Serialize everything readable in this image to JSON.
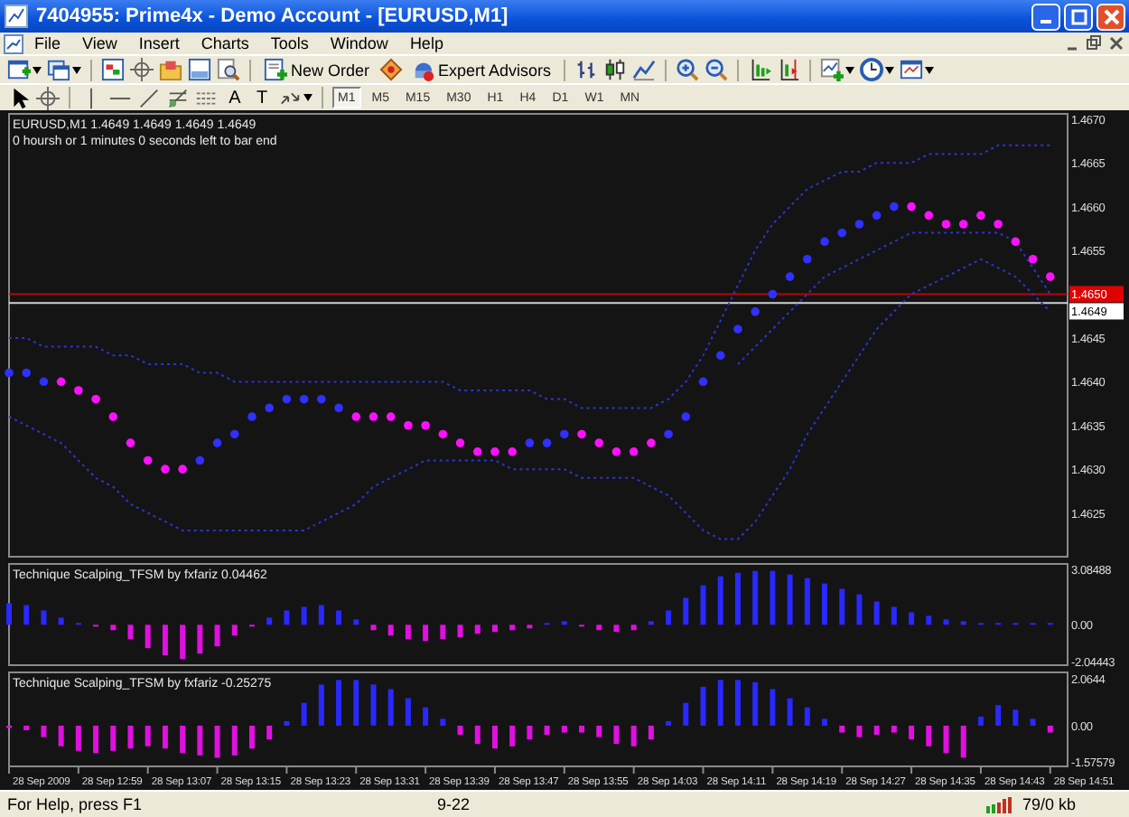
{
  "window": {
    "title": "7404955: Prime4x - Demo Account - [EURUSD,M1]"
  },
  "menu": [
    "File",
    "View",
    "Insert",
    "Charts",
    "Tools",
    "Window",
    "Help"
  ],
  "toolbar": {
    "new_order": "New Order",
    "expert_advisors": "Expert Advisors",
    "text_tool": "A",
    "label_tool": "T",
    "timeframes": [
      {
        "label": "M1",
        "selected": true
      },
      {
        "label": "M5",
        "selected": false
      },
      {
        "label": "M15",
        "selected": false
      },
      {
        "label": "M30",
        "selected": false
      },
      {
        "label": "H1",
        "selected": false
      },
      {
        "label": "H4",
        "selected": false
      },
      {
        "label": "D1",
        "selected": false
      },
      {
        "label": "W1",
        "selected": false
      },
      {
        "label": "MN",
        "selected": false
      }
    ]
  },
  "chart": {
    "countdown": "0 hoursh or 1 minutes 0 seconds left to bar end",
    "main": {
      "chart_data": {
        "type": "line",
        "title": "EURUSD,M1  1.4649 1.4649 1.4649 1.4649",
        "ylim": [
          1.462,
          1.46706
        ],
        "yticks": [
          {
            "value": 1.4625,
            "label": "1.4625"
          },
          {
            "value": 1.463,
            "label": "1.4630"
          },
          {
            "value": 1.4635,
            "label": "1.4635"
          },
          {
            "value": 1.464,
            "label": "1.4640"
          },
          {
            "value": 1.4645,
            "label": "1.4645"
          },
          {
            "value": 1.4655,
            "label": "1.4655"
          },
          {
            "value": 1.466,
            "label": "1.4660"
          },
          {
            "value": 1.4665,
            "label": "1.4665"
          },
          {
            "value": 1.467,
            "label": "1.4670"
          }
        ],
        "series": [
          {
            "color": "#2a35d0",
            "line_style": "dotted",
            "values": [
              1.4645,
              1.4645,
              1.4644,
              1.4644,
              1.4644,
              1.4644,
              1.4643,
              1.4643,
              1.4642,
              1.4642,
              1.4642,
              1.4641,
              1.4641,
              1.464,
              1.464,
              1.464,
              1.464,
              1.464,
              1.464,
              1.464,
              1.464,
              1.464,
              1.464,
              1.464,
              1.464,
              1.464,
              1.4639,
              1.4639,
              1.4639,
              1.4639,
              1.4639,
              1.4638,
              1.4638,
              1.4637,
              1.4637,
              1.4637,
              1.4637,
              1.4637,
              1.4638,
              1.464,
              1.4643,
              1.4647,
              1.4651,
              1.4655,
              1.4658,
              1.466,
              1.4662,
              1.4663,
              1.4664,
              1.4664,
              1.4665,
              1.4665,
              1.4665,
              1.4666,
              1.4666,
              1.4666,
              1.4666,
              1.4667,
              1.4667,
              1.4667,
              1.4667
            ]
          },
          {
            "color": "#2a35d0",
            "line_style": "dotted",
            "values": [
              1.4636,
              1.4635,
              1.4634,
              1.4633,
              1.4631,
              1.4629,
              1.4628,
              1.4626,
              1.4625,
              1.4624,
              1.4623,
              1.4623,
              1.4623,
              1.4623,
              1.4623,
              1.4623,
              1.4623,
              1.4623,
              1.4624,
              1.4625,
              1.4626,
              1.4628,
              1.4629,
              1.463,
              1.4631,
              1.4631,
              1.4631,
              1.4631,
              1.4631,
              1.463,
              1.463,
              1.463,
              1.463,
              1.4629,
              1.4629,
              1.4629,
              1.4629,
              1.4628,
              1.4627,
              1.4625,
              1.4623,
              1.4622,
              1.4622,
              1.4624,
              1.4627,
              1.463,
              1.4634,
              1.4637,
              1.464,
              1.4643,
              1.4646,
              1.4648,
              1.465,
              1.4651,
              1.4652,
              1.4653,
              1.4654,
              1.4653,
              1.4652,
              1.465,
              1.4648
            ]
          },
          {
            "color": "#2a35d0",
            "line_style": "dotted",
            "values": [
              null,
              null,
              null,
              null,
              null,
              null,
              null,
              null,
              null,
              null,
              null,
              null,
              null,
              null,
              null,
              null,
              null,
              null,
              null,
              null,
              null,
              null,
              null,
              null,
              null,
              null,
              null,
              null,
              null,
              null,
              null,
              null,
              null,
              null,
              null,
              null,
              null,
              null,
              null,
              null,
              null,
              null,
              1.4642,
              1.4644,
              1.4646,
              1.4648,
              1.465,
              1.4652,
              1.4653,
              1.4654,
              1.4655,
              1.4656,
              1.4657,
              1.4657,
              1.4657,
              1.4657,
              1.4657,
              1.4657,
              1.4656,
              1.4653,
              1.465
            ]
          },
          {
            "color": "#3030ff",
            "type": "scatter",
            "marker": "circle",
            "values": [
              1.4641,
              1.4641,
              1.464,
              null,
              null,
              null,
              null,
              null,
              null,
              null,
              null,
              1.4631,
              1.4633,
              1.4634,
              1.4636,
              1.4637,
              1.4638,
              1.4638,
              1.4638,
              1.4637,
              null,
              null,
              null,
              null,
              null,
              null,
              null,
              null,
              null,
              null,
              1.4633,
              1.4633,
              1.4634,
              null,
              null,
              null,
              null,
              null,
              1.4634,
              1.4636,
              1.464,
              1.4643,
              1.4646,
              1.4648,
              1.465,
              1.4652,
              1.4654,
              1.4656,
              1.4657,
              1.4658,
              1.4659,
              1.466,
              null,
              null,
              null,
              null,
              null,
              null,
              null,
              null,
              null
            ]
          },
          {
            "color": "#ff10ff",
            "type": "scatter",
            "marker": "circle",
            "values": [
              null,
              null,
              null,
              1.464,
              1.4639,
              1.4638,
              1.4636,
              1.4633,
              1.4631,
              1.463,
              1.463,
              null,
              null,
              null,
              null,
              null,
              null,
              null,
              null,
              null,
              1.4636,
              1.4636,
              1.4636,
              1.4635,
              1.4635,
              1.4634,
              1.4633,
              1.4632,
              1.4632,
              1.4632,
              null,
              null,
              null,
              1.4634,
              1.4633,
              1.4632,
              1.4632,
              1.4633,
              null,
              null,
              null,
              null,
              null,
              null,
              null,
              null,
              null,
              null,
              null,
              null,
              null,
              null,
              1.466,
              1.4659,
              1.4658,
              1.4658,
              1.4659,
              1.4658,
              1.4656,
              1.4654,
              1.4652
            ]
          }
        ],
        "ref_lines": [
          {
            "axis": "y",
            "value": 1.465,
            "label": "1.4650",
            "color": "#e00000"
          },
          {
            "axis": "y",
            "value": 1.4649,
            "label": "1.4649",
            "color": "#ffffff"
          }
        ]
      }
    },
    "indicator_1": {
      "chart_data": {
        "type": "bar",
        "title": "Technique Scalping_TFSM by fxfariz 0.04462",
        "ylim": [
          -2.25,
          3.39
        ],
        "yticks": [
          {
            "value": 3.08488,
            "label": "3.08488"
          },
          {
            "value": 0,
            "label": "0.00"
          },
          {
            "value": -2.04443,
            "label": "-2.04443"
          }
        ],
        "series": [
          {
            "color": "#2828ff",
            "values": [
              1.2,
              1.1,
              0.8,
              0.4,
              0.1,
              null,
              null,
              null,
              null,
              null,
              null,
              null,
              null,
              null,
              null,
              0.4,
              0.8,
              1.0,
              1.1,
              0.8,
              0.3,
              null,
              null,
              null,
              null,
              null,
              null,
              null,
              null,
              null,
              null,
              0.1,
              0.2,
              null,
              null,
              null,
              null,
              0.2,
              0.8,
              1.5,
              2.2,
              2.7,
              2.9,
              3.0,
              3.0,
              2.8,
              2.6,
              2.3,
              2.0,
              1.7,
              1.3,
              1.0,
              0.7,
              0.5,
              0.3,
              0.2,
              0.1,
              0.1,
              0.1,
              0.1,
              0.1
            ]
          },
          {
            "color": "#e010e0",
            "values": [
              null,
              null,
              null,
              null,
              null,
              -0.1,
              -0.3,
              -0.8,
              -1.3,
              -1.7,
              -1.9,
              -1.6,
              -1.2,
              -0.6,
              -0.1,
              null,
              null,
              null,
              null,
              null,
              null,
              -0.3,
              -0.6,
              -0.8,
              -0.9,
              -0.8,
              -0.7,
              -0.5,
              -0.4,
              -0.3,
              -0.2,
              null,
              null,
              -0.1,
              -0.3,
              -0.4,
              -0.3,
              null,
              null,
              null,
              null,
              null,
              null,
              null,
              null,
              null,
              null,
              null,
              null,
              null,
              null,
              null,
              null,
              null,
              null,
              null,
              null,
              null,
              null,
              null,
              null
            ]
          }
        ]
      }
    },
    "indicator_2": {
      "chart_data": {
        "type": "bar",
        "title": "Technique Scalping_TFSM by fxfariz -0.25275",
        "ylim": [
          -1.78,
          2.33
        ],
        "yticks": [
          {
            "value": 2.0644,
            "label": "2.0644"
          },
          {
            "value": 0,
            "label": "0.00"
          },
          {
            "value": -1.57579,
            "label": "-1.57579"
          }
        ],
        "series": [
          {
            "color": "#2828ff",
            "values": [
              null,
              null,
              null,
              null,
              null,
              null,
              null,
              null,
              null,
              null,
              null,
              null,
              null,
              null,
              null,
              null,
              0.2,
              1.0,
              1.8,
              2.0,
              2.0,
              1.8,
              1.6,
              1.2,
              0.8,
              0.3,
              null,
              null,
              null,
              null,
              null,
              null,
              null,
              null,
              null,
              null,
              null,
              null,
              0.2,
              1.0,
              1.7,
              2.0,
              2.0,
              1.9,
              1.6,
              1.2,
              0.8,
              0.3,
              null,
              null,
              null,
              null,
              null,
              null,
              null,
              null,
              0.4,
              0.9,
              0.7,
              0.3,
              null
            ]
          },
          {
            "color": "#e010e0",
            "values": [
              -0.1,
              -0.2,
              -0.5,
              -0.9,
              -1.1,
              -1.2,
              -1.1,
              -1.0,
              -0.9,
              -1.0,
              -1.2,
              -1.3,
              -1.4,
              -1.3,
              -1.0,
              -0.6,
              null,
              null,
              null,
              null,
              null,
              null,
              null,
              null,
              null,
              null,
              -0.4,
              -0.8,
              -1.0,
              -0.9,
              -0.6,
              -0.4,
              -0.3,
              -0.3,
              -0.5,
              -0.8,
              -0.9,
              -0.6,
              null,
              null,
              null,
              null,
              null,
              null,
              null,
              null,
              null,
              null,
              -0.3,
              -0.5,
              -0.4,
              -0.3,
              -0.6,
              -0.9,
              -1.2,
              -1.4,
              null,
              null,
              null,
              null,
              -0.3
            ]
          }
        ]
      }
    },
    "time_axis": [
      "28 Sep 2009",
      "28 Sep 12:59",
      "28 Sep 13:07",
      "28 Sep 13:15",
      "28 Sep 13:23",
      "28 Sep 13:31",
      "28 Sep 13:39",
      "28 Sep 13:47",
      "28 Sep 13:55",
      "28 Sep 14:03",
      "28 Sep 14:11",
      "28 Sep 14:19",
      "28 Sep 14:27",
      "28 Sep 14:35",
      "28 Sep 14:43",
      "28 Sep 14:51"
    ]
  },
  "status_bar": {
    "help": "For Help, press F1",
    "profile": "9-22",
    "traffic": "79/0 kb"
  }
}
